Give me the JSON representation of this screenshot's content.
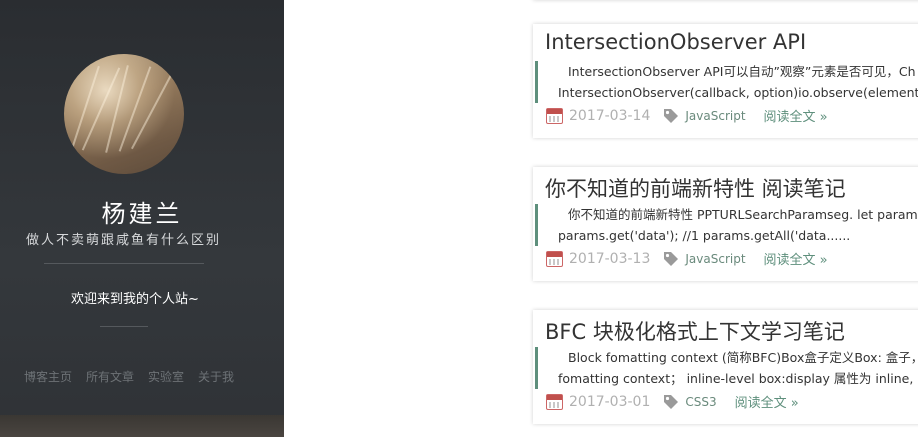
{
  "profile": {
    "name": "杨建兰",
    "motto": "做人不卖萌跟咸鱼有什么区别",
    "welcome": "欢迎来到我的个人站~"
  },
  "nav": [
    "博客主页",
    "所有文章",
    "实验室",
    "关于我"
  ],
  "articles": [
    {
      "title": "IntersectionObserver API",
      "excerpt_line1": "IntersectionObserver API可以自动”观察”元素是否可见，Ch",
      "excerpt_line2": "IntersectionObserver(callback, option)io.observe(element); /",
      "date": "2017-03-14",
      "tag": "JavaScript",
      "read_more": "阅读全文 »"
    },
    {
      "title": "你不知道的前端新特性 阅读笔记",
      "excerpt_line1": "你不知道的前端新特性 PPTURLSearchParamseg. let params",
      "excerpt_line2": "params.get('data'); //1 params.getAll('data......",
      "date": "2017-03-13",
      "tag": "JavaScript",
      "read_more": "阅读全文 »"
    },
    {
      "title": "BFC 块极化格式上下文学习笔记",
      "excerpt_line1": "Block fomatting context (简称BFC)Box盒子定义Box: 盒子，布",
      "excerpt_line2": "fomatting context；  inline-level box:display 属性为 inline, inl",
      "date": "2017-03-01",
      "tag": "CSS3",
      "read_more": "阅读全文 »"
    }
  ],
  "colors": {
    "accent": "#5e8f7c",
    "sidebar_bg": "#2f3236"
  }
}
